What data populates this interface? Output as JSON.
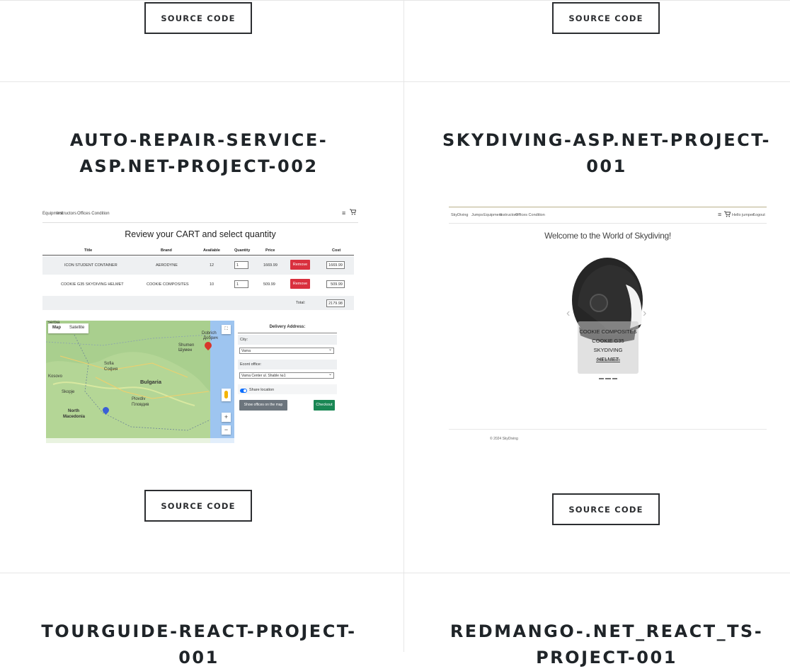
{
  "buttons": {
    "source_code_top_left": "SOURCE CODE",
    "source_code_top_right": "SOURCE CODE",
    "source_code_mid_left": "SOURCE CODE",
    "source_code_mid_right": "SOURCE CODE"
  },
  "projects": [
    {
      "title_line1": "AUTO-REPAIR-SERVICE-",
      "title_line2": "ASP.NET-PROJECT-002"
    },
    {
      "title_line1": "SKYDIVING-ASP.NET-PROJECT-",
      "title_line2": "001"
    },
    {
      "title_line1": "TOURGUIDE-REACT-PROJECT-",
      "title_line2": "001"
    },
    {
      "title_line1": "REDMANGO-.NET_REACT_TS-",
      "title_line2": "PROJECT-001"
    }
  ],
  "cart_shot": {
    "nav": {
      "equipment": "Equipment",
      "instructors": "Instructors",
      "offices": "Offices Condition"
    },
    "heading": "Review your CART and select quantity",
    "columns": [
      "Title",
      "Brand",
      "Available",
      "Quantity",
      "Price",
      "Cost"
    ],
    "rows": [
      {
        "title": "ICON STUDENT CONTAINER",
        "brand": "AERODYNE",
        "available": "12",
        "quantity": "1",
        "price": "1669.99",
        "remove": "Remove",
        "cost": "1669.99"
      },
      {
        "title": "COOKIE G35 SKYDIVING HELMET",
        "brand": "COOKIE COMPOSITES",
        "available": "10",
        "quantity": "1",
        "price": "509.99",
        "remove": "Remove",
        "cost": "509.99"
      }
    ],
    "total_label": "Total:",
    "total_value": "2179.98",
    "map": {
      "tab_map": "Map",
      "tab_satellite": "Satellite",
      "country": "Bulgaria",
      "kosovo": "Kosovo",
      "north": "North",
      "macedonia": "Macedonia",
      "sofia": "Sofia",
      "sofia_cyr": "София",
      "plovdiv": "Plovdiv",
      "plovdiv_cyr": "Пловдив",
      "skopje": "Skopje",
      "shumen": "Shumen",
      "shumen_cyr": "Шумен",
      "serbia": "Serbia",
      "dobrich": "Dobrich",
      "dobrich_cyr": "Добрич"
    },
    "delivery": {
      "title": "Delivery Address:",
      "city_label": "City:",
      "city_value": "Varna",
      "office_label": "Econt office:",
      "office_value": "Varna Center ul. Shable №1",
      "share_label": "Share location",
      "show_offices": "Show offices on the map",
      "checkout": "Checkout"
    }
  },
  "sky_shot": {
    "brand": "SkyDiving",
    "nav": [
      "Jumps",
      "Equipment",
      "Instructors",
      "Offices Condition"
    ],
    "user": "Hello jumper!",
    "logout": "Logout",
    "welcome": "Welcome to the World of Skydiving!",
    "caption_line1": "COOKIE COMPOSITES",
    "caption_line2": "COOKIE G35 SKYDIVING",
    "caption_line3": "HELMET",
    "caption_link": "Click for details",
    "footer": "© 2024 SkyDiving"
  },
  "colors": {
    "button_border": "#2b2d30",
    "remove": "#d9303e",
    "checkout": "#198754",
    "show_offices": "#6c757d"
  }
}
